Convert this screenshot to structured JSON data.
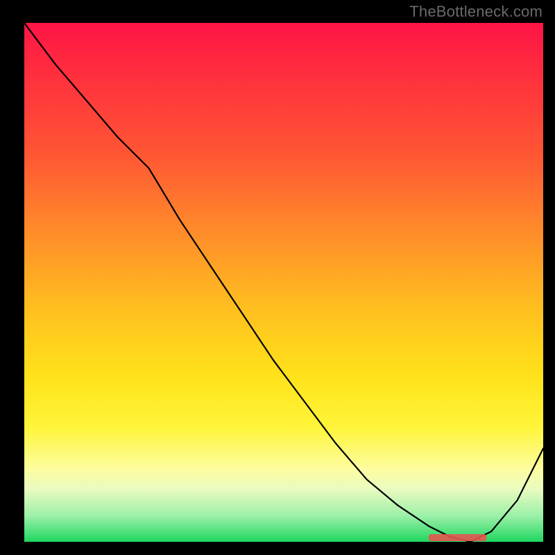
{
  "watermark": "TheBottleneck.com",
  "chart_data": {
    "type": "line",
    "title": "",
    "xlabel": "",
    "ylabel": "",
    "x": [
      0.0,
      0.06,
      0.12,
      0.18,
      0.24,
      0.3,
      0.36,
      0.42,
      0.48,
      0.54,
      0.6,
      0.66,
      0.72,
      0.78,
      0.82,
      0.86,
      0.9,
      0.95,
      1.0
    ],
    "y": [
      1.0,
      0.92,
      0.85,
      0.78,
      0.72,
      0.62,
      0.53,
      0.44,
      0.35,
      0.27,
      0.19,
      0.12,
      0.07,
      0.03,
      0.01,
      0.0,
      0.02,
      0.08,
      0.18
    ],
    "xlim": [
      0,
      1
    ],
    "ylim": [
      0,
      1
    ],
    "highlight_region_x": [
      0.78,
      0.89
    ],
    "highlight_region_y_fraction": 0.004
  }
}
